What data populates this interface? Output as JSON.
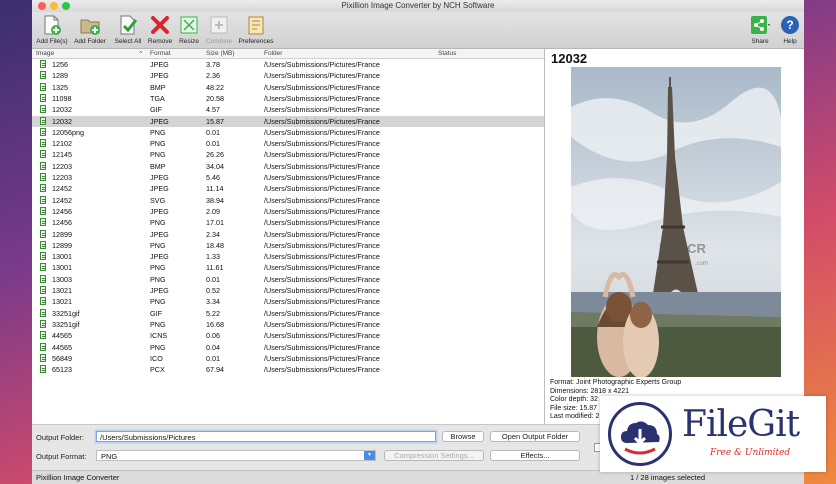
{
  "app": {
    "title": "Pixillion Image Converter by NCH Software",
    "status_left": "Pixillion Image Converter",
    "status_right": "1 / 28 images selected"
  },
  "toolbar": {
    "add_files": "Add File(s)",
    "add_folder": "Add Folder",
    "select_all": "Select All",
    "remove": "Remove",
    "resize": "Resize",
    "combine": "Combine",
    "preferences": "Preferences",
    "share": "Share",
    "help": "Help"
  },
  "columns": {
    "image": "Image",
    "format": "Format",
    "size": "Size (MB)",
    "folder": "Folder",
    "status": "Status"
  },
  "files": [
    {
      "name": "1256",
      "format": "JPEG",
      "size": "3.78",
      "folder": "/Users/Submissions/Pictures/France"
    },
    {
      "name": "1289",
      "format": "JPEG",
      "size": "2.36",
      "folder": "/Users/Submissions/Pictures/France"
    },
    {
      "name": "1325",
      "format": "BMP",
      "size": "48.22",
      "folder": "/Users/Submissions/Pictures/France"
    },
    {
      "name": "11098",
      "format": "TGA",
      "size": "20.58",
      "folder": "/Users/Submissions/Pictures/France"
    },
    {
      "name": "12032",
      "format": "GIF",
      "size": "4.57",
      "folder": "/Users/Submissions/Pictures/France"
    },
    {
      "name": "12032",
      "format": "JPEG",
      "size": "15.87",
      "folder": "/Users/Submissions/Pictures/France"
    },
    {
      "name": "12056png",
      "format": "PNG",
      "size": "0.01",
      "folder": "/Users/Submissions/Pictures/France"
    },
    {
      "name": "12102",
      "format": "PNG",
      "size": "0.01",
      "folder": "/Users/Submissions/Pictures/France"
    },
    {
      "name": "12145",
      "format": "PNG",
      "size": "26.26",
      "folder": "/Users/Submissions/Pictures/France"
    },
    {
      "name": "12203",
      "format": "BMP",
      "size": "34.04",
      "folder": "/Users/Submissions/Pictures/France"
    },
    {
      "name": "12203",
      "format": "JPEG",
      "size": "5.46",
      "folder": "/Users/Submissions/Pictures/France"
    },
    {
      "name": "12452",
      "format": "JPEG",
      "size": "11.14",
      "folder": "/Users/Submissions/Pictures/France"
    },
    {
      "name": "12452",
      "format": "SVG",
      "size": "38.94",
      "folder": "/Users/Submissions/Pictures/France"
    },
    {
      "name": "12456",
      "format": "JPEG",
      "size": "2.09",
      "folder": "/Users/Submissions/Pictures/France"
    },
    {
      "name": "12456",
      "format": "PNG",
      "size": "17.01",
      "folder": "/Users/Submissions/Pictures/France"
    },
    {
      "name": "12899",
      "format": "JPEG",
      "size": "2.34",
      "folder": "/Users/Submissions/Pictures/France"
    },
    {
      "name": "12899",
      "format": "PNG",
      "size": "18.48",
      "folder": "/Users/Submissions/Pictures/France"
    },
    {
      "name": "13001",
      "format": "JPEG",
      "size": "1.33",
      "folder": "/Users/Submissions/Pictures/France"
    },
    {
      "name": "13001",
      "format": "PNG",
      "size": "11.61",
      "folder": "/Users/Submissions/Pictures/France"
    },
    {
      "name": "13003",
      "format": "PNG",
      "size": "0.01",
      "folder": "/Users/Submissions/Pictures/France"
    },
    {
      "name": "13021",
      "format": "JPEG",
      "size": "0.52",
      "folder": "/Users/Submissions/Pictures/France"
    },
    {
      "name": "13021",
      "format": "PNG",
      "size": "3.34",
      "folder": "/Users/Submissions/Pictures/France"
    },
    {
      "name": "33251gif",
      "format": "GIF",
      "size": "5.22",
      "folder": "/Users/Submissions/Pictures/France"
    },
    {
      "name": "33251gif",
      "format": "PNG",
      "size": "16.68",
      "folder": "/Users/Submissions/Pictures/France"
    },
    {
      "name": "44565",
      "format": "ICNS",
      "size": "0.06",
      "folder": "/Users/Submissions/Pictures/France"
    },
    {
      "name": "44565",
      "format": "PNG",
      "size": "0.04",
      "folder": "/Users/Submissions/Pictures/France"
    },
    {
      "name": "56849",
      "format": "ICO",
      "size": "0.01",
      "folder": "/Users/Submissions/Pictures/France"
    },
    {
      "name": "65123",
      "format": "PCX",
      "size": "67.94",
      "folder": "/Users/Submissions/Pictures/France"
    }
  ],
  "preview": {
    "title": "12032",
    "watermark": "FILECR",
    "watermark_sub": ".com",
    "info": [
      "Format: Joint Photographic Experts Group",
      "Dimensions: 2818 x 4221",
      "Color depth: 32",
      "File size: 15.87",
      "Last modified: 2"
    ]
  },
  "output": {
    "folder_label": "Output Folder:",
    "folder_value": "/Users/Submissions/Pictures",
    "browse": "Browse",
    "open_folder": "Open Output Folder",
    "format_label": "Output Format:",
    "format_value": "PNG",
    "compression": "Compression Settings...",
    "effects": "Effects..."
  },
  "overlay": {
    "brand": "FileGit",
    "tagline": "Free & Unlimited"
  }
}
